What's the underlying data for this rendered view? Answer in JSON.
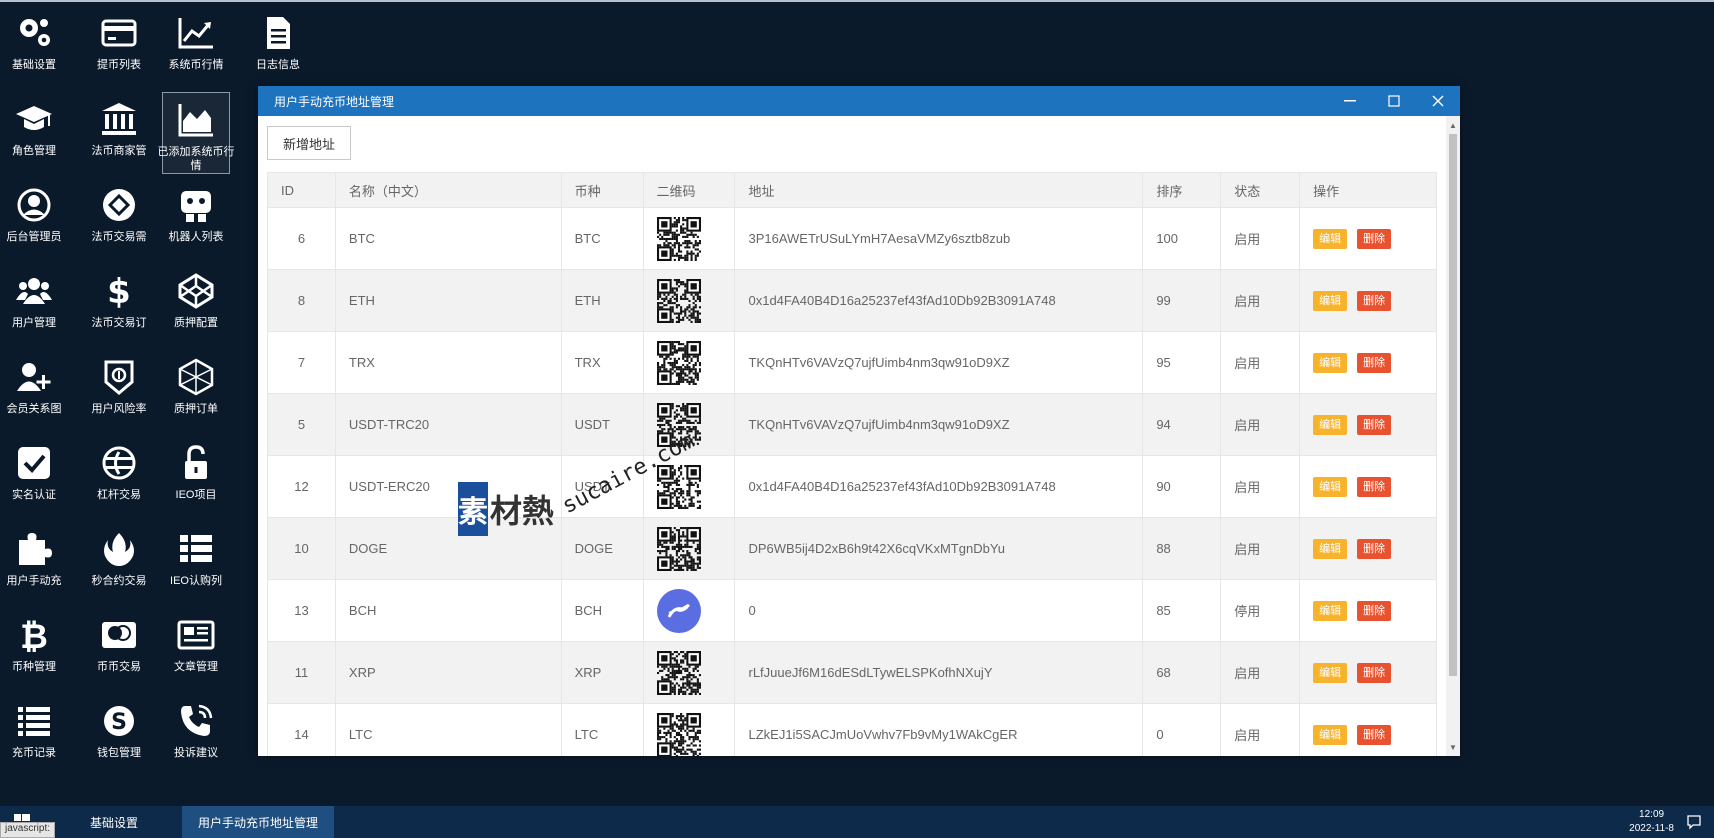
{
  "desktop": {
    "icons": [
      {
        "label": "基础设置",
        "icon": "gears-icon"
      },
      {
        "label": "提币列表",
        "icon": "credit-card-icon"
      },
      {
        "label": "系统币行情",
        "icon": "line-chart-icon"
      },
      {
        "label": "日志信息",
        "icon": "document-icon"
      },
      {
        "label": "角色管理",
        "icon": "graduation-cap-icon"
      },
      {
        "label": "法币商家管",
        "icon": "bank-icon"
      },
      {
        "label": "已添加系统币行情",
        "icon": "area-chart-icon"
      },
      {
        "label": "后台管理员",
        "icon": "user-circle-icon"
      },
      {
        "label": "法币交易需",
        "icon": "exchange-icon"
      },
      {
        "label": "机器人列表",
        "icon": "robot-icon"
      },
      {
        "label": "用户管理",
        "icon": "users-icon"
      },
      {
        "label": "法币交易订",
        "icon": "dollar-icon"
      },
      {
        "label": "质押配置",
        "icon": "codepen-icon"
      },
      {
        "label": "会员关系图",
        "icon": "user-plus-icon"
      },
      {
        "label": "用户风险率",
        "icon": "shield-icon"
      },
      {
        "label": "质押订单",
        "icon": "cube-icon"
      },
      {
        "label": "实名认证",
        "icon": "check-square-icon"
      },
      {
        "label": "杠杆交易",
        "icon": "lever-icon"
      },
      {
        "label": "IEO项目",
        "icon": "unlock-icon"
      },
      {
        "label": "用户手动充",
        "icon": "puzzle-icon"
      },
      {
        "label": "秒合约交易",
        "icon": "rebel-icon"
      },
      {
        "label": "IEO认购列",
        "icon": "list-icon"
      },
      {
        "label": "币种管理",
        "icon": "bitcoin-icon"
      },
      {
        "label": "币币交易",
        "icon": "mastercard-icon"
      },
      {
        "label": "文章管理",
        "icon": "newspaper-icon"
      },
      {
        "label": "充币记录",
        "icon": "list-lines-icon"
      },
      {
        "label": "钱包管理",
        "icon": "skype-icon"
      },
      {
        "label": "投诉建议",
        "icon": "phone-icon"
      }
    ]
  },
  "window": {
    "title": "用户手动充币地址管理",
    "add_button": "新增地址",
    "columns": [
      "ID",
      "名称（中文）",
      "币种",
      "二维码",
      "地址",
      "排序",
      "状态",
      "操作"
    ],
    "edit_label": "编辑",
    "delete_label": "删除",
    "rows": [
      {
        "id": "6",
        "name": "BTC",
        "coin": "BTC",
        "address": "3P16AWETrUSuLYmH7AesaVMZy6sztb8zub",
        "sort": "100",
        "status": "启用",
        "qr": "qr"
      },
      {
        "id": "8",
        "name": "ETH",
        "coin": "ETH",
        "address": "0x1d4FA40B4D16a25237ef43fAd10Db92B3091A748",
        "sort": "99",
        "status": "启用",
        "qr": "qr"
      },
      {
        "id": "7",
        "name": "TRX",
        "coin": "TRX",
        "address": "TKQnHTv6VAVzQ7ujfUimb4nm3qw91oD9XZ",
        "sort": "95",
        "status": "启用",
        "qr": "qr"
      },
      {
        "id": "5",
        "name": "USDT-TRC20",
        "coin": "USDT",
        "address": "TKQnHTv6VAVzQ7ujfUimb4nm3qw91oD9XZ",
        "sort": "94",
        "status": "启用",
        "qr": "qr"
      },
      {
        "id": "12",
        "name": "USDT-ERC20",
        "coin": "USDT",
        "address": "0x1d4FA40B4D16a25237ef43fAd10Db92B3091A748",
        "sort": "90",
        "status": "启用",
        "qr": "qr"
      },
      {
        "id": "10",
        "name": "DOGE",
        "coin": "DOGE",
        "address": "DP6WB5ij4D2xB6h9t42X6cqVKxMTgnDbYu",
        "sort": "88",
        "status": "启用",
        "qr": "qr"
      },
      {
        "id": "13",
        "name": "BCH",
        "coin": "BCH",
        "address": "0",
        "sort": "85",
        "status": "停用",
        "qr": "logo"
      },
      {
        "id": "11",
        "name": "XRP",
        "coin": "XRP",
        "address": "rLfJuueJf6M16dESdLTywELSPKofhNXujY",
        "sort": "68",
        "status": "启用",
        "qr": "qr"
      },
      {
        "id": "14",
        "name": "LTC",
        "coin": "LTC",
        "address": "LZkEJ1i5SACJmUoVwhv7Fb9vMy1WAkCgER",
        "sort": "0",
        "status": "启用",
        "qr": "qr"
      }
    ]
  },
  "watermark": {
    "cn_first": "素",
    "cn_rest": "材熱",
    "en": "sucaire.com"
  },
  "taskbar": {
    "tasks": [
      {
        "label": "基础设置",
        "active": false
      },
      {
        "label": "用户手动充币地址管理",
        "active": true
      }
    ],
    "time": "12:09",
    "date": "2022-11-8",
    "status_text": "javascript:"
  },
  "colors": {
    "accent": "#1e73be",
    "edit": "#f6b32b",
    "delete": "#e9522f",
    "desktop_bg": "#0b1a2b"
  }
}
